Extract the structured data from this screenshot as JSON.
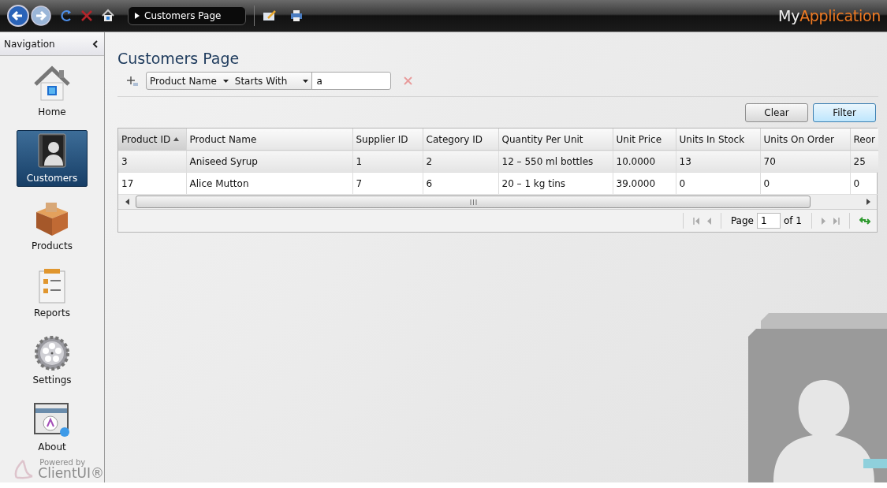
{
  "toolbar": {
    "breadcrumb": "Customers Page",
    "logo_part_1": "My",
    "logo_part_2": "Application"
  },
  "navigation": {
    "title": "Navigation",
    "items": [
      {
        "label": "Home",
        "kind": "home",
        "selected": false
      },
      {
        "label": "Customers",
        "kind": "customers",
        "selected": true
      },
      {
        "label": "Products",
        "kind": "products",
        "selected": false
      },
      {
        "label": "Reports",
        "kind": "reports",
        "selected": false
      },
      {
        "label": "Settings",
        "kind": "settings",
        "selected": false
      },
      {
        "label": "About",
        "kind": "about",
        "selected": false
      }
    ],
    "powered_by": "Powered by",
    "brand": "ClientUI®"
  },
  "page": {
    "title": "Customers Page"
  },
  "filter": {
    "field": "Product Name",
    "operator": "Starts With",
    "value": "a"
  },
  "buttons": [
    {
      "label": "Clear",
      "default": false
    },
    {
      "label": "Filter",
      "default": true
    }
  ],
  "table": {
    "columns": [
      {
        "label": "Product ID",
        "sorted": true
      },
      {
        "label": "Product Name",
        "sorted": false
      },
      {
        "label": "Supplier ID",
        "sorted": false
      },
      {
        "label": "Category ID",
        "sorted": false
      },
      {
        "label": "Quantity Per Unit",
        "sorted": false
      },
      {
        "label": "Unit Price",
        "sorted": false
      },
      {
        "label": "Units In Stock",
        "sorted": false
      },
      {
        "label": "Units On Order",
        "sorted": false
      },
      {
        "label": "Reor",
        "sorted": false
      }
    ],
    "rows": [
      {
        "selected": true,
        "cells": [
          "3",
          "Aniseed Syrup",
          "1",
          "2",
          "12 – 550 ml bottles",
          "10.0000",
          "13",
          "70",
          "25"
        ]
      },
      {
        "selected": false,
        "cells": [
          "17",
          "Alice Mutton",
          "7",
          "6",
          "20 – 1 kg tins",
          "39.0000",
          "0",
          "0",
          "0"
        ]
      }
    ]
  },
  "pager": {
    "page_label": "Page",
    "page": "1",
    "of_label": "of 1"
  }
}
